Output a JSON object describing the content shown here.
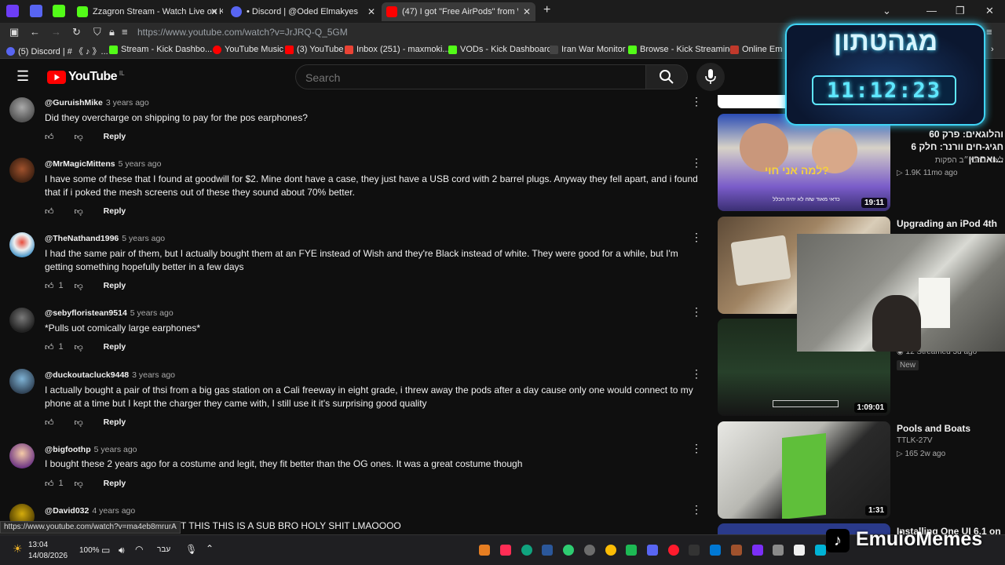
{
  "browser": {
    "tabs": [
      {
        "title": "Zzagron Stream - Watch Live on Kick",
        "active": false
      },
      {
        "title": "• Discord | @Oded Elmakyes",
        "active": false
      },
      {
        "title": "(47) I got \"Free AirPods\" from Wish",
        "active": true
      }
    ],
    "url": "https://www.youtube.com/watch?v=JrJRQ-Q_5GM",
    "bookmarks": [
      "(5) Discord | # 《 ♪ 》...",
      "Stream - Kick Dashbo...",
      "YouTube Music",
      "(3) YouTube",
      "Inbox (251) - maxmoki...",
      "VODs - Kick Dashboard",
      "Iran War Monitor",
      "Browse - Kick Streaming",
      "Online Em"
    ],
    "status_url": "https://www.youtube.com/watch?v=ma4eb8mrurA"
  },
  "youtube": {
    "logo_text": "YouTube",
    "region": "IL",
    "search_placeholder": "Search"
  },
  "comments": [
    {
      "handle": "@GuruishMike",
      "time": "3 years ago",
      "text": "Did they overcharge on shipping to pay for the pos earphones?",
      "likes": "",
      "reply": "Reply"
    },
    {
      "handle": "@MrMagicMittens",
      "time": "5 years ago",
      "text": "I have some of these that I found at goodwill for $2. Mine dont have a case, they just have a USB cord with 2 barrel plugs. Anyway they fell apart, and i found that if i poked the mesh screens out of these they sound about 70% better.",
      "likes": "",
      "reply": "Reply"
    },
    {
      "handle": "@TheNathand1996",
      "time": "5 years ago",
      "text": "I had the same pair of them, but I actually bought them at an FYE instead of Wish and they're Black instead of white. They were good for a while, but I'm getting something hopefully better in a few days",
      "likes": "1",
      "reply": "Reply"
    },
    {
      "handle": "@sebyfloristean9514",
      "time": "5 years ago",
      "text": "*Pulls uot comically large earphones*",
      "likes": "1",
      "reply": "Reply"
    },
    {
      "handle": "@duckoutacluck9448",
      "time": "3 years ago",
      "text": "I actually bought a pair of thsi from a big gas station on a Cali freeway in eight grade, i threw away the pods after a day cause only one would connect to my phone at a time but I kept the charger they came with, I still use it it's surprising good quality",
      "likes": "",
      "reply": "Reply"
    },
    {
      "handle": "@bigfoothp",
      "time": "5 years ago",
      "text": "I bought these 2 years ago for a costume and legit, they fit better than the OG ones. It was a great costume though",
      "likes": "1",
      "reply": "Reply"
    },
    {
      "handle": "@David032",
      "time": "4 years ago",
      "text": "T THIS THIS IS A SUB BRO HOLY SHIT LMAOOOO",
      "likes": "",
      "reply": ""
    }
  ],
  "recommendations": [
    {
      "title": "והלוגאים: פרק 60 חגיג-חים וורנר: חלק 6 ואחרון...",
      "channel": "לאור ברביי״ב הפקות",
      "meta": "1.9K  11mo ago",
      "duration": "19:11",
      "overlay": "למה אני חוי?",
      "caption": "כדאי מאוד שזה לא יהיה הכלל",
      "badge": ""
    },
    {
      "title": "Upgrading an iPod 4th",
      "channel": "",
      "meta": "",
      "duration": "",
      "overlay": "",
      "caption": "",
      "badge": ""
    },
    {
      "title": "",
      "channel": "",
      "meta": "12 Streamed 3d ago",
      "duration": "1:09:01",
      "overlay": "",
      "caption": "",
      "badge": "New"
    },
    {
      "title": "Pools and Boats",
      "channel": "TTLK-27V",
      "meta": "165  2w ago",
      "duration": "1:31",
      "overlay": "",
      "caption": "",
      "badge": ""
    },
    {
      "title": "Installing One UI 6.1 on",
      "channel": "",
      "meta": "",
      "duration": "",
      "overlay": "",
      "caption": "",
      "badge": ""
    }
  ],
  "stream_overlay": {
    "title": "מגהטתון",
    "timer": "11:12:23",
    "watermark": "EmuioMemes"
  },
  "taskbar": {
    "time": "13:04",
    "date": "14/08/2026",
    "battery": "100%",
    "language": "עבר"
  },
  "colors": {
    "accent_red": "#ff0000",
    "background": "#0f0f0f",
    "timer_cyan": "#5ee7ff"
  }
}
